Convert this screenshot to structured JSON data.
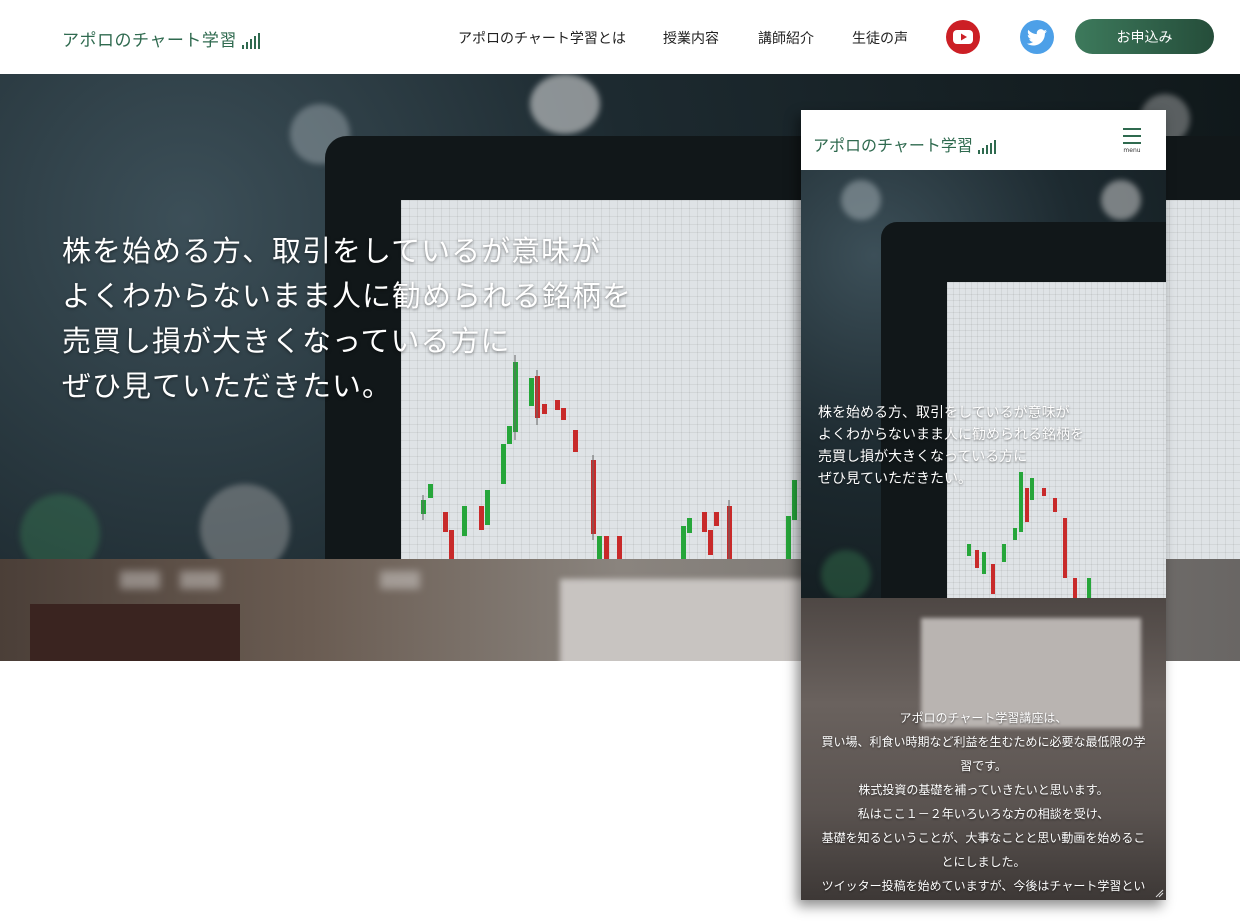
{
  "header": {
    "logo_text": "アポロのチャート学習",
    "nav": [
      {
        "label": "アポロのチャート学習とは"
      },
      {
        "label": "授業内容"
      },
      {
        "label": "講師紹介"
      },
      {
        "label": "生徒の声"
      }
    ],
    "youtube_icon": "youtube-icon",
    "twitter_icon": "twitter-icon",
    "apply_label": "お申込み",
    "colors": {
      "brand": "#2f6a4f",
      "youtube": "#cc1f25",
      "twitter": "#4da0e8"
    }
  },
  "hero": {
    "lines": [
      "株を始める方、取引をしているが意味が",
      "よくわからないまま人に勧められる銘柄を",
      "売買し損が大きくなっている方に",
      "ぜひ見ていただきたい。"
    ]
  },
  "mobile": {
    "logo_text": "アポロのチャート学習",
    "menu_label": "menu",
    "hero_lines": [
      "株を始める方、取引をしているが意味が",
      "よくわからないまま人に勧められる銘柄を",
      "売買し損が大きくなっている方に",
      "ぜひ見ていただきたい。"
    ],
    "about_lines": [
      "アポロのチャート学習講座は、",
      "買い場、利食い時期など利益を生むために必要な最低限の学",
      "習です。",
      "株式投資の基礎を補っていきたいと思います。",
      "私はここ１－２年いろいろな方の相談を受け、",
      "基礎を知るということが、大事なことと思い動画を始めるこ",
      "とにしました。",
      "ツイッター投稿を始めていますが、今後はチャート学習とい"
    ]
  }
}
